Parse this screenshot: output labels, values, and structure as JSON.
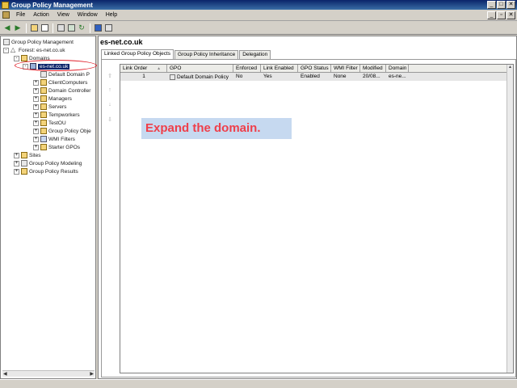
{
  "window": {
    "title": "Group Policy Management",
    "buttons": [
      "_",
      "□",
      "✕"
    ]
  },
  "menubar": {
    "items": [
      "File",
      "Action",
      "View",
      "Window",
      "Help"
    ],
    "mdi_buttons": [
      "_",
      "▫",
      "✕"
    ]
  },
  "toolbar": {
    "icons": [
      "back-icon",
      "forward-icon",
      "up-folder-icon",
      "show-tree-icon",
      "properties-icon",
      "export-icon",
      "refresh-icon",
      "help-icon",
      "console-icon"
    ]
  },
  "tree": {
    "root": "Group Policy Management",
    "forest": "Forest: es-net.co.uk",
    "domains": "Domains",
    "domain": "es-net.co.uk",
    "children": [
      "Default Domain Policy",
      "ClientComputers",
      "Domain Controllers",
      "Managers",
      "Servers",
      "Tempworkers",
      "TestOU",
      "Group Policy Objects",
      "WMI Filters",
      "Starter GPOs"
    ],
    "sites": "Sites",
    "modeling": "Group Policy Modeling",
    "results": "Group Policy Results",
    "child_labels_visible": [
      "Default Domain P",
      "ClientComputers",
      "Domain Controller",
      "Managers",
      "Servers",
      "Tempworkers",
      "TestOU",
      "Group Policy Obje",
      "WMI Filters",
      "Starter GPOs"
    ]
  },
  "right": {
    "scope_title": "es-net.co.uk",
    "tabs": [
      "Linked Group Policy Objects",
      "Group Policy Inheritance",
      "Delegation"
    ],
    "columns": [
      "Link Order",
      "GPO",
      "Enforced",
      "Link Enabled",
      "GPO Status",
      "WMI Filter",
      "Modified",
      "Domain"
    ],
    "sort_indicator": "▲",
    "rows": [
      {
        "link_order": "1",
        "gpo": "Default Domain Policy",
        "enforced": "No",
        "link_enabled": "Yes",
        "gpo_status": "Enabled",
        "wmi_filter": "None",
        "modified": "20/08...",
        "domain": "es-ne..."
      }
    ]
  },
  "callout": {
    "text": "Expand the domain."
  },
  "colors": {
    "titlebar": "#0a246a",
    "callout_bg": "#c6d9f0",
    "callout_text": "#ef3f4a",
    "highlight": "#e0202a"
  }
}
